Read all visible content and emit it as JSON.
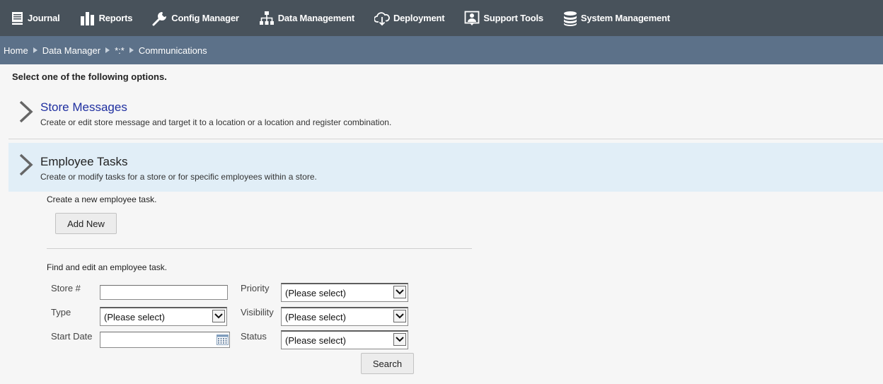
{
  "nav": {
    "items": [
      {
        "label": "Journal",
        "icon": "journal-icon"
      },
      {
        "label": "Reports",
        "icon": "reports-icon"
      },
      {
        "label": "Config Manager",
        "icon": "wrench-icon"
      },
      {
        "label": "Data Management",
        "icon": "hierarchy-icon"
      },
      {
        "label": "Deployment",
        "icon": "cloud-download-icon"
      },
      {
        "label": "Support Tools",
        "icon": "support-person-icon"
      },
      {
        "label": "System Management",
        "icon": "database-icon"
      }
    ]
  },
  "breadcrumb": [
    "Home",
    "Data Manager",
    "*:*",
    "Communications"
  ],
  "instruction": "Select one of the following options.",
  "options": [
    {
      "title": "Store Messages",
      "description": "Create or edit store message and target it to a location or a location and register combination."
    },
    {
      "title": "Employee Tasks",
      "description": "Create or modify tasks for a store or for specific employees within a store."
    }
  ],
  "panel": {
    "create_text": "Create a new employee task.",
    "add_new_label": "Add New",
    "find_text": "Find and edit an employee task.",
    "fields": {
      "store_label": "Store #",
      "store_value": "",
      "type_label": "Type",
      "type_value": "(Please select)",
      "start_date_label": "Start Date",
      "start_date_value": "",
      "priority_label": "Priority",
      "priority_value": "(Please select)",
      "visibility_label": "Visibility",
      "visibility_value": "(Please select)",
      "status_label": "Status",
      "status_value": "(Please select)"
    },
    "search_label": "Search"
  },
  "colors": {
    "topnav_bg": "#48525b",
    "breadcrumb_bg": "#5c7189",
    "selected_option_bg": "#e1eef7",
    "link_title": "#1f2fa0"
  }
}
